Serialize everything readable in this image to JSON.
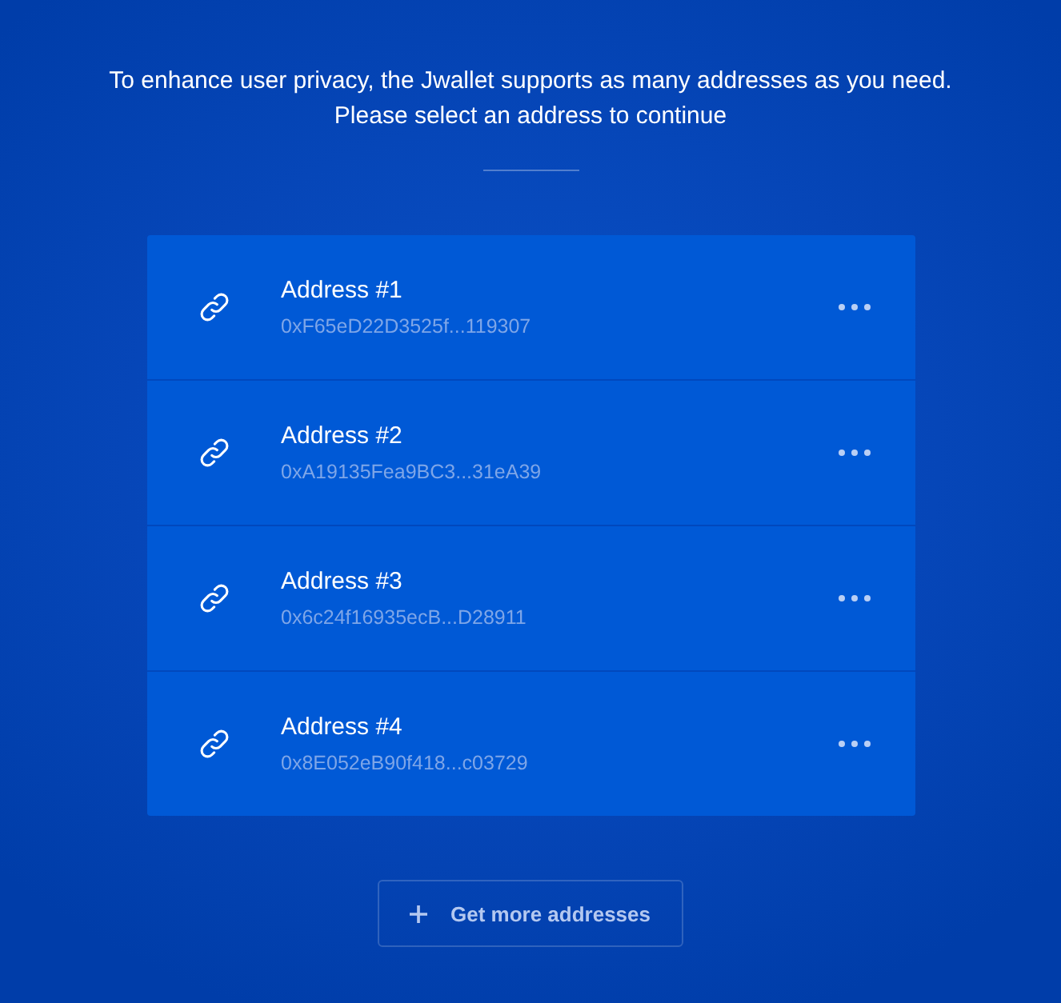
{
  "intro": {
    "lines": [
      "To enhance user privacy, the Jwallet supports as many addresses as you need.",
      "Please select an address to continue"
    ]
  },
  "addresses": [
    {
      "name": "Address #1",
      "address": "0xF65eD22D3525f...119307"
    },
    {
      "name": "Address #2",
      "address": "0xA19135Fea9BC3...31eA39"
    },
    {
      "name": "Address #3",
      "address": "0x6c24f16935ecB...D28911"
    },
    {
      "name": "Address #4",
      "address": "0x8E052eB90f418...c03729"
    }
  ],
  "button": {
    "label": "Get more addresses"
  }
}
